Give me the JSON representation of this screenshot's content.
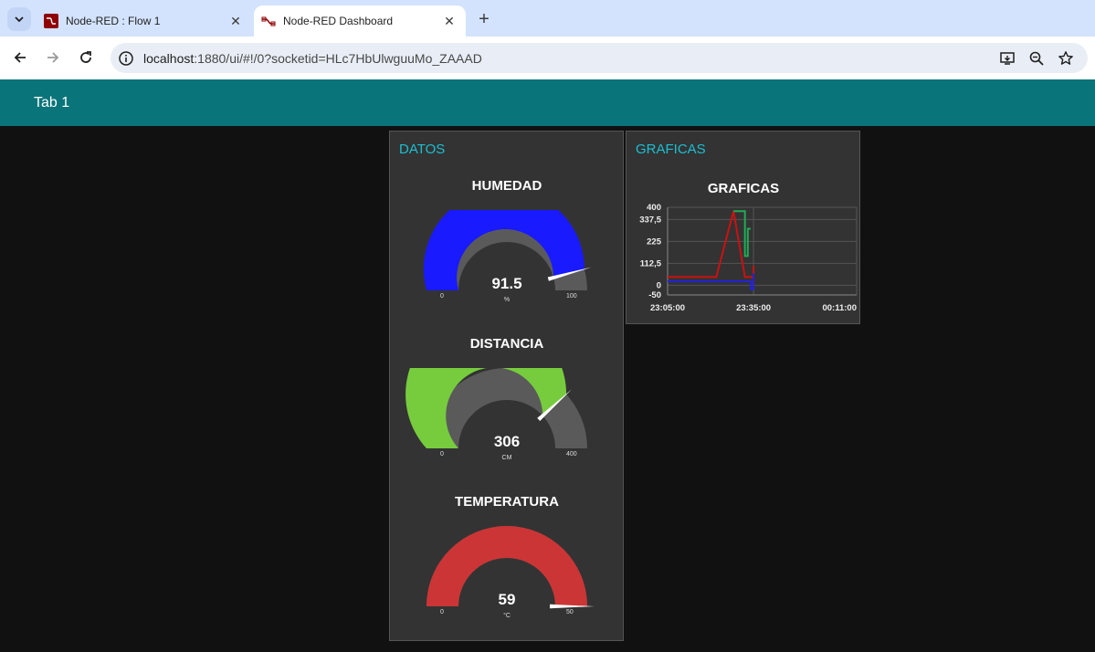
{
  "browser": {
    "tabs": [
      {
        "title": "Node-RED : Flow 1",
        "active": false
      },
      {
        "title": "Node-RED Dashboard",
        "active": true
      }
    ],
    "url_host": "localhost",
    "url_rest": ":1880/ui/#!/0?socketid=HLc7HbUlwguuMo_ZAAAD"
  },
  "dashboard": {
    "tab_title": "Tab 1",
    "accent_color": "#097479",
    "groups": {
      "datos": {
        "title": "DATOS",
        "gauges": [
          {
            "title": "HUMEDAD",
            "value": "91.5",
            "unit": "%",
            "min": "0",
            "max": "100",
            "min_num": 0,
            "max_num": 100,
            "value_num": 91.5,
            "color": "#1a1aff"
          },
          {
            "title": "DISTANCIA",
            "value": "306",
            "unit": "CM",
            "min": "0",
            "max": "400",
            "min_num": 0,
            "max_num": 400,
            "value_num": 306,
            "color": "#77cc3d"
          },
          {
            "title": "TEMPERATURA",
            "value": "59",
            "unit": "°C",
            "min": "0",
            "max": "50",
            "min_num": 0,
            "max_num": 50,
            "value_num": 59,
            "color": "#cc3535"
          }
        ]
      },
      "graficas": {
        "title": "GRAFICAS",
        "chart_title": "GRAFICAS"
      }
    }
  },
  "chart_data": {
    "type": "line",
    "title": "GRAFICAS",
    "xlabel": "",
    "ylabel": "",
    "x_tick_labels": [
      "23:05:00",
      "23:35:00",
      "00:11:00"
    ],
    "y_tick_labels": [
      "400",
      "337,5",
      "225",
      "112,5",
      "0",
      "-50"
    ],
    "y_ticks": [
      400,
      337.5,
      225,
      112.5,
      0,
      -50
    ],
    "ylim": [
      -50,
      400
    ],
    "x_minutes_range": [
      0,
      66
    ],
    "grid": true,
    "series": [
      {
        "color": "#cc1111",
        "points": [
          [
            0,
            42
          ],
          [
            17,
            42
          ],
          [
            23,
            380
          ],
          [
            27,
            42
          ],
          [
            30,
            42
          ],
          [
            30,
            100
          ],
          [
            30,
            0
          ]
        ]
      },
      {
        "color": "#2222dd",
        "points": [
          [
            0,
            20
          ],
          [
            29,
            20
          ],
          [
            29,
            -20
          ],
          [
            30,
            -20
          ],
          [
            30,
            60
          ]
        ]
      },
      {
        "color": "#22aa55",
        "points": [
          [
            23,
            380
          ],
          [
            27,
            380
          ],
          [
            27,
            150
          ],
          [
            28,
            150
          ],
          [
            28,
            290
          ],
          [
            29,
            290
          ]
        ]
      }
    ]
  }
}
